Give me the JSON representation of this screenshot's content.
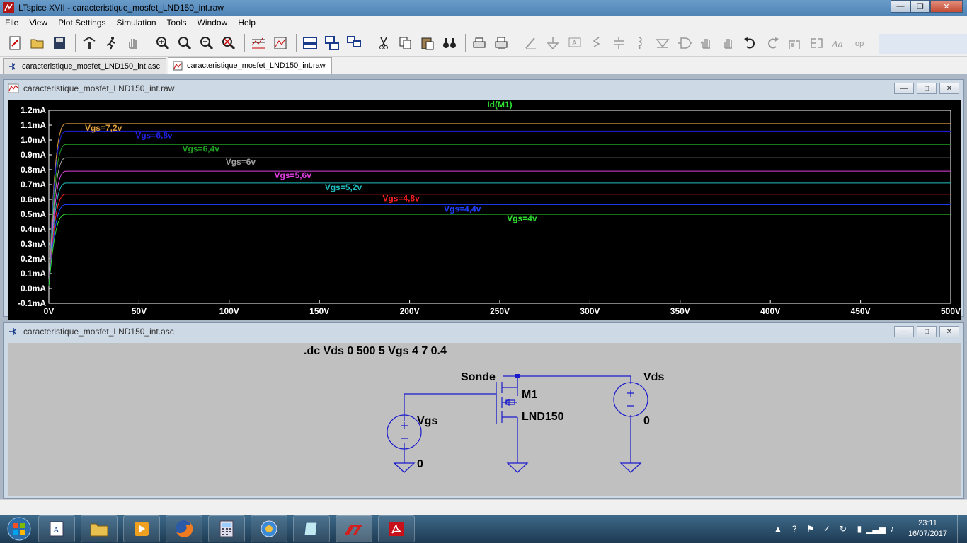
{
  "window": {
    "title": "LTspice XVII - caracteristique_mosfet_LND150_int.raw"
  },
  "menu": [
    "File",
    "View",
    "Plot Settings",
    "Simulation",
    "Tools",
    "Window",
    "Help"
  ],
  "tabs": [
    {
      "label": "caracteristique_mosfet_LND150_int.asc",
      "active": false
    },
    {
      "label": "caracteristique_mosfet_LND150_int.raw",
      "active": true
    }
  ],
  "plot_window": {
    "title": "caracteristique_mosfet_LND150_int.raw"
  },
  "schematic_window": {
    "title": "caracteristique_mosfet_LND150_int.asc"
  },
  "chart_data": {
    "type": "line",
    "title": "Id(M1)",
    "xlabel": "",
    "ylabel": "",
    "x_unit": "V",
    "xlim": [
      0,
      500
    ],
    "ylim": [
      -0.1,
      1.2
    ],
    "xticks": [
      "0V",
      "50V",
      "100V",
      "150V",
      "200V",
      "250V",
      "300V",
      "350V",
      "400V",
      "450V",
      "500V"
    ],
    "yticks": [
      "1.2mA",
      "1.1mA",
      "1.0mA",
      "0.9mA",
      "0.8mA",
      "0.7mA",
      "0.6mA",
      "0.5mA",
      "0.4mA",
      "0.3mA",
      "0.2mA",
      "0.1mA",
      "0.0mA",
      "-0.1mA"
    ],
    "series": [
      {
        "name": "Vgs=7,2v",
        "color": "#e0a040",
        "sat_mA": 1.11,
        "label_x": 20
      },
      {
        "name": "Vgs=6,8v",
        "color": "#2020e0",
        "sat_mA": 1.06,
        "label_x": 48
      },
      {
        "name": "Vgs=6,4v",
        "color": "#20a020",
        "sat_mA": 0.97,
        "label_x": 74
      },
      {
        "name": "Vgs=6v",
        "color": "#a0a0a0",
        "sat_mA": 0.88,
        "label_x": 98
      },
      {
        "name": "Vgs=5,6v",
        "color": "#e040e0",
        "sat_mA": 0.79,
        "label_x": 125
      },
      {
        "name": "Vgs=5,2v",
        "color": "#20c0c0",
        "sat_mA": 0.71,
        "label_x": 153
      },
      {
        "name": "Vgs=4,8v",
        "color": "#ff2020",
        "sat_mA": 0.635,
        "label_x": 185
      },
      {
        "name": "Vgs=4,4v",
        "color": "#2040ff",
        "sat_mA": 0.565,
        "label_x": 219
      },
      {
        "name": "Vgs=4v",
        "color": "#30e030",
        "sat_mA": 0.5,
        "label_x": 254
      }
    ],
    "grid": false,
    "legend": "inline labels"
  },
  "schematic": {
    "directive": ".dc Vds 0 500 5 Vgs 4 7 0.4",
    "probe_label": "Sonde",
    "mosfet_name": "M1",
    "mosfet_model": "LND150",
    "source_gate": "Vgs",
    "source_gate_value": "0",
    "source_drain": "Vds",
    "source_drain_value": "0"
  },
  "taskbar": {
    "time": "23:11",
    "date": "16/07/2017"
  }
}
